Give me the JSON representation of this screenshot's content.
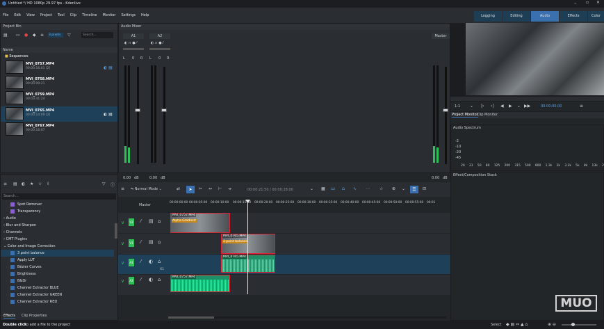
{
  "window": {
    "title": "Untitled */ HD 1080p 29.97 fps - Kdenlive"
  },
  "menu": [
    "File",
    "Edit",
    "View",
    "Project",
    "Tool",
    "Clip",
    "Timeline",
    "Monitor",
    "Settings",
    "Help"
  ],
  "workspaces": [
    "Logging",
    "Editing",
    "Audio",
    "Effects",
    "Color"
  ],
  "active_workspace": "Audio",
  "project_bin": {
    "title": "Project Bin",
    "search_placeholder": "Search...",
    "filter_label": "3 pixels",
    "column": "Name",
    "folder": "Sequences",
    "clips": [
      {
        "name": "MVI_0757.MP4",
        "duration": "00:00:16:01 [2]"
      },
      {
        "name": "MVI_0758.MP4",
        "duration": "00:00:09:21"
      },
      {
        "name": "MVI_0759.MP4",
        "duration": "00:03:41:24"
      },
      {
        "name": "MVI_0765.MP4",
        "duration": "00:00:14:09 [2]"
      },
      {
        "name": "MVI_0767.MP4",
        "duration": "00:00:16:07"
      }
    ]
  },
  "audio_mixer": {
    "title": "Audio Mixer",
    "channels": [
      "A1",
      "A2"
    ],
    "master": "Master",
    "lr": [
      "L",
      "0",
      "R",
      "L",
      "0",
      "R"
    ],
    "db_values": [
      "0.00",
      "dB",
      "0.00",
      "dB"
    ],
    "master_db": [
      "0.00",
      "dB"
    ]
  },
  "effects": {
    "search_placeholder": "Search...",
    "items": [
      "Spot Remover",
      "Transparency"
    ],
    "categories": [
      "Audio",
      "Blur and Sharpen",
      "Channels",
      "CMT Plugins",
      "Color and Image Correction"
    ],
    "color_items": [
      "3 point balance",
      "Apply LUT",
      "Bézier Curves",
      "Brightness",
      "B&Dr",
      "Channel Extractor BLUE",
      "Channel Extractor GREEN",
      "Channel Extractor RED"
    ],
    "tabs": [
      "Effects",
      "Clip Properties"
    ]
  },
  "monitor": {
    "timecode": "00:00:00,00",
    "zoom": "1:1",
    "tabs": [
      "Project Monitor",
      "Clip Monitor"
    ]
  },
  "audio_spectrum": {
    "title": "Audio Spectrum",
    "db_labels": [
      "-2",
      "-10",
      "-20",
      "-45"
    ],
    "freq_labels": [
      "20",
      "31",
      "50",
      "80",
      "125",
      "200",
      "315",
      "500",
      "800",
      "1.3k",
      "2k",
      "3.2k",
      "5k",
      "8k",
      "13k",
      "2"
    ]
  },
  "effect_stack": {
    "title": "Effect/Composition Stack"
  },
  "timeline": {
    "mode": "Normal Mode",
    "timecode": "00:00:21:50 / 00:00:28:00",
    "master": "Master",
    "ruler": [
      "00:00:00:00",
      "00:00:05:00",
      "00:00:10:00",
      "00:00:15:00",
      "00:00:20:00",
      "00:00:25:00",
      "00:00:30:00",
      "00:00:35:00",
      "00:00:40:00",
      "00:00:45:00",
      "00:00:50:00",
      "00:00:55:00",
      "00:01"
    ],
    "tracks": [
      "V2",
      "V1",
      "A1",
      "A2"
    ],
    "clips": [
      {
        "name": "MVI_0757.MP4",
        "effect": "Alpha Gradient"
      },
      {
        "name": "MVI_0765.MP4",
        "effect": "3 point balance"
      },
      {
        "name": "MVI_0765.MP4",
        "effect": ""
      },
      {
        "name": "MVI_0757.MP4",
        "effect": ""
      }
    ],
    "x_label": "X1"
  },
  "statusbar": {
    "hint_bold": "Double click",
    "hint": "to add a file to the project",
    "select": "Select"
  },
  "watermark": "MUO"
}
